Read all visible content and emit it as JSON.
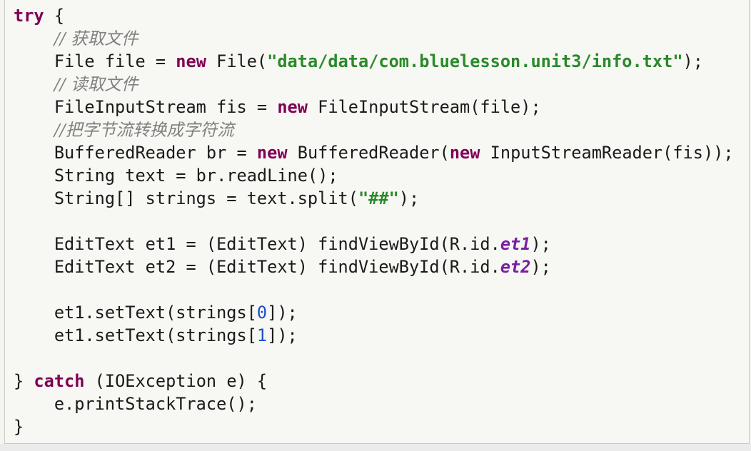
{
  "code": {
    "lines": [
      [
        {
          "t": "try",
          "k": "kw"
        },
        {
          "t": " {",
          "k": ""
        }
      ],
      [
        {
          "t": "    ",
          "k": ""
        },
        {
          "t": "// 获取文件",
          "k": "cmt"
        }
      ],
      [
        {
          "t": "    File file = ",
          "k": ""
        },
        {
          "t": "new",
          "k": "kw"
        },
        {
          "t": " File(",
          "k": ""
        },
        {
          "t": "\"data/data/com.bluelesson.unit3/info.txt\"",
          "k": "str"
        },
        {
          "t": ");",
          "k": ""
        }
      ],
      [
        {
          "t": "    ",
          "k": ""
        },
        {
          "t": "// 读取文件",
          "k": "cmt"
        }
      ],
      [
        {
          "t": "    FileInputStream fis = ",
          "k": ""
        },
        {
          "t": "new",
          "k": "kw"
        },
        {
          "t": " FileInputStream(file);",
          "k": ""
        }
      ],
      [
        {
          "t": "    ",
          "k": ""
        },
        {
          "t": "//把字节流转换成字符流",
          "k": "cmt"
        }
      ],
      [
        {
          "t": "    BufferedReader br = ",
          "k": ""
        },
        {
          "t": "new",
          "k": "kw"
        },
        {
          "t": " BufferedReader(",
          "k": ""
        },
        {
          "t": "new",
          "k": "kw"
        },
        {
          "t": " InputStreamReader(fis));",
          "k": ""
        }
      ],
      [
        {
          "t": "    String text = br.readLine();",
          "k": ""
        }
      ],
      [
        {
          "t": "    String[] strings = text.split(",
          "k": ""
        },
        {
          "t": "\"##\"",
          "k": "str"
        },
        {
          "t": ");",
          "k": ""
        }
      ],
      [],
      [
        {
          "t": "    EditText et1 = (EditText) findViewById(R.id.",
          "k": ""
        },
        {
          "t": "et1",
          "k": "fld"
        },
        {
          "t": ");",
          "k": ""
        }
      ],
      [
        {
          "t": "    EditText et2 = (EditText) findViewById(R.id.",
          "k": ""
        },
        {
          "t": "et2",
          "k": "fld"
        },
        {
          "t": ");",
          "k": ""
        }
      ],
      [],
      [
        {
          "t": "    et1.setText(strings[",
          "k": ""
        },
        {
          "t": "0",
          "k": "num"
        },
        {
          "t": "]);",
          "k": ""
        }
      ],
      [
        {
          "t": "    et1.setText(strings[",
          "k": ""
        },
        {
          "t": "1",
          "k": "num"
        },
        {
          "t": "]);",
          "k": ""
        }
      ],
      [],
      [
        {
          "t": "} ",
          "k": ""
        },
        {
          "t": "catch",
          "k": "kw"
        },
        {
          "t": " (IOException e) {",
          "k": ""
        }
      ],
      [
        {
          "t": "    e.printStackTrace();",
          "k": ""
        }
      ],
      [
        {
          "t": "}",
          "k": ""
        }
      ]
    ]
  },
  "colors": {
    "keyword": "#7f0055",
    "string": "#2a8a2a",
    "comment": "#808080",
    "field": "#7a1fa2",
    "number": "#1a52c8"
  }
}
